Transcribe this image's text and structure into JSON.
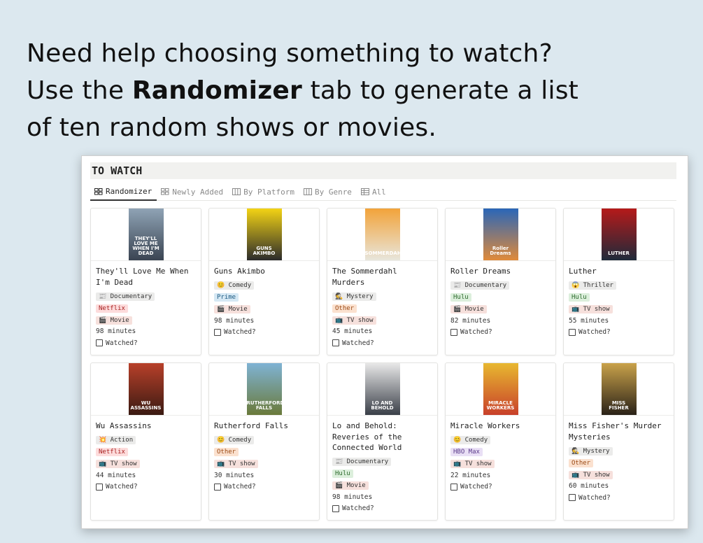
{
  "headline": {
    "line1": "Need help choosing something to watch?",
    "line2_pre": "Use the ",
    "line2_bold": "Randomizer",
    "line2_post": " tab to generate a list",
    "line3": "of ten random shows or movies."
  },
  "database": {
    "title": "TO WATCH",
    "tabs": [
      {
        "label": "Randomizer",
        "icon": "gallery-icon",
        "active": true
      },
      {
        "label": "Newly Added",
        "icon": "gallery-icon",
        "active": false
      },
      {
        "label": "By Platform",
        "icon": "board-icon",
        "active": false
      },
      {
        "label": "By Genre",
        "icon": "board-icon",
        "active": false
      },
      {
        "label": "All",
        "icon": "table-icon",
        "active": false
      }
    ],
    "watched_label": "Watched?",
    "cards": [
      {
        "title": "They'll Love Me When I'm Dead",
        "genre": "📰 Documentary",
        "platform": "Netflix",
        "type": "🎬 Movie",
        "minutes": "98 minutes",
        "poster_text": "THEY'LL LOVE ME WHEN I'M DEAD",
        "poster_colors": [
          "#8fa3b5",
          "#3a4452"
        ]
      },
      {
        "title": "Guns Akimbo",
        "genre": "😊 Comedy",
        "platform": "Prime",
        "type": "🎬 Movie",
        "minutes": "98 minutes",
        "poster_text": "GUNS AKIMBO",
        "poster_colors": [
          "#f3d314",
          "#2b2b2b"
        ]
      },
      {
        "title": "The Sommerdahl Murders",
        "genre": "🕵 Mystery",
        "platform": "Other",
        "type": "📺 TV show",
        "minutes": "45 minutes",
        "poster_text": "SOMMERDAHL",
        "poster_colors": [
          "#f2a33a",
          "#e8e6dc"
        ]
      },
      {
        "title": "Roller Dreams",
        "genre": "📰 Documentary",
        "platform": "Hulu",
        "type": "🎬 Movie",
        "minutes": "82 minutes",
        "poster_text": "Roller Dreams",
        "poster_colors": [
          "#2a66b8",
          "#e08a3a"
        ]
      },
      {
        "title": "Luther",
        "genre": "😱 Thriller",
        "platform": "Hulu",
        "type": "📺 TV show",
        "minutes": "55 minutes",
        "poster_text": "LUTHER",
        "poster_colors": [
          "#b51a1a",
          "#1f2a3a"
        ]
      },
      {
        "title": "Wu Assassins",
        "genre": "💥 Action",
        "platform": "Netflix",
        "type": "📺 TV show",
        "minutes": "44 minutes",
        "poster_text": "WU ASSASSINS",
        "poster_colors": [
          "#b8402a",
          "#3a1a12"
        ]
      },
      {
        "title": "Rutherford Falls",
        "genre": "😊 Comedy",
        "platform": "Other",
        "type": "📺 TV show",
        "minutes": "30 minutes",
        "poster_text": "RUTHERFORD FALLS",
        "poster_colors": [
          "#7fb3d4",
          "#6a7a3a"
        ]
      },
      {
        "title": "Lo and Behold: Reveries of the Connected World",
        "genre": "📰 Documentary",
        "platform": "Hulu",
        "type": "🎬 Movie",
        "minutes": "98 minutes",
        "poster_text": "LO AND BEHOLD",
        "poster_colors": [
          "#e8e8e8",
          "#3a3f48"
        ]
      },
      {
        "title": "Miracle Workers",
        "genre": "😊 Comedy",
        "platform": "HBO Max",
        "type": "📺 TV show",
        "minutes": "22 minutes",
        "poster_text": "MIRACLE WORKERS",
        "poster_colors": [
          "#e8b830",
          "#c8402a"
        ]
      },
      {
        "title": "Miss Fisher's Murder Mysteries",
        "genre": "🕵 Mystery",
        "platform": "Other",
        "type": "📺 TV show",
        "minutes": "60 minutes",
        "poster_text": "MISS FISHER",
        "poster_colors": [
          "#c9a24a",
          "#2a2218"
        ]
      }
    ]
  }
}
